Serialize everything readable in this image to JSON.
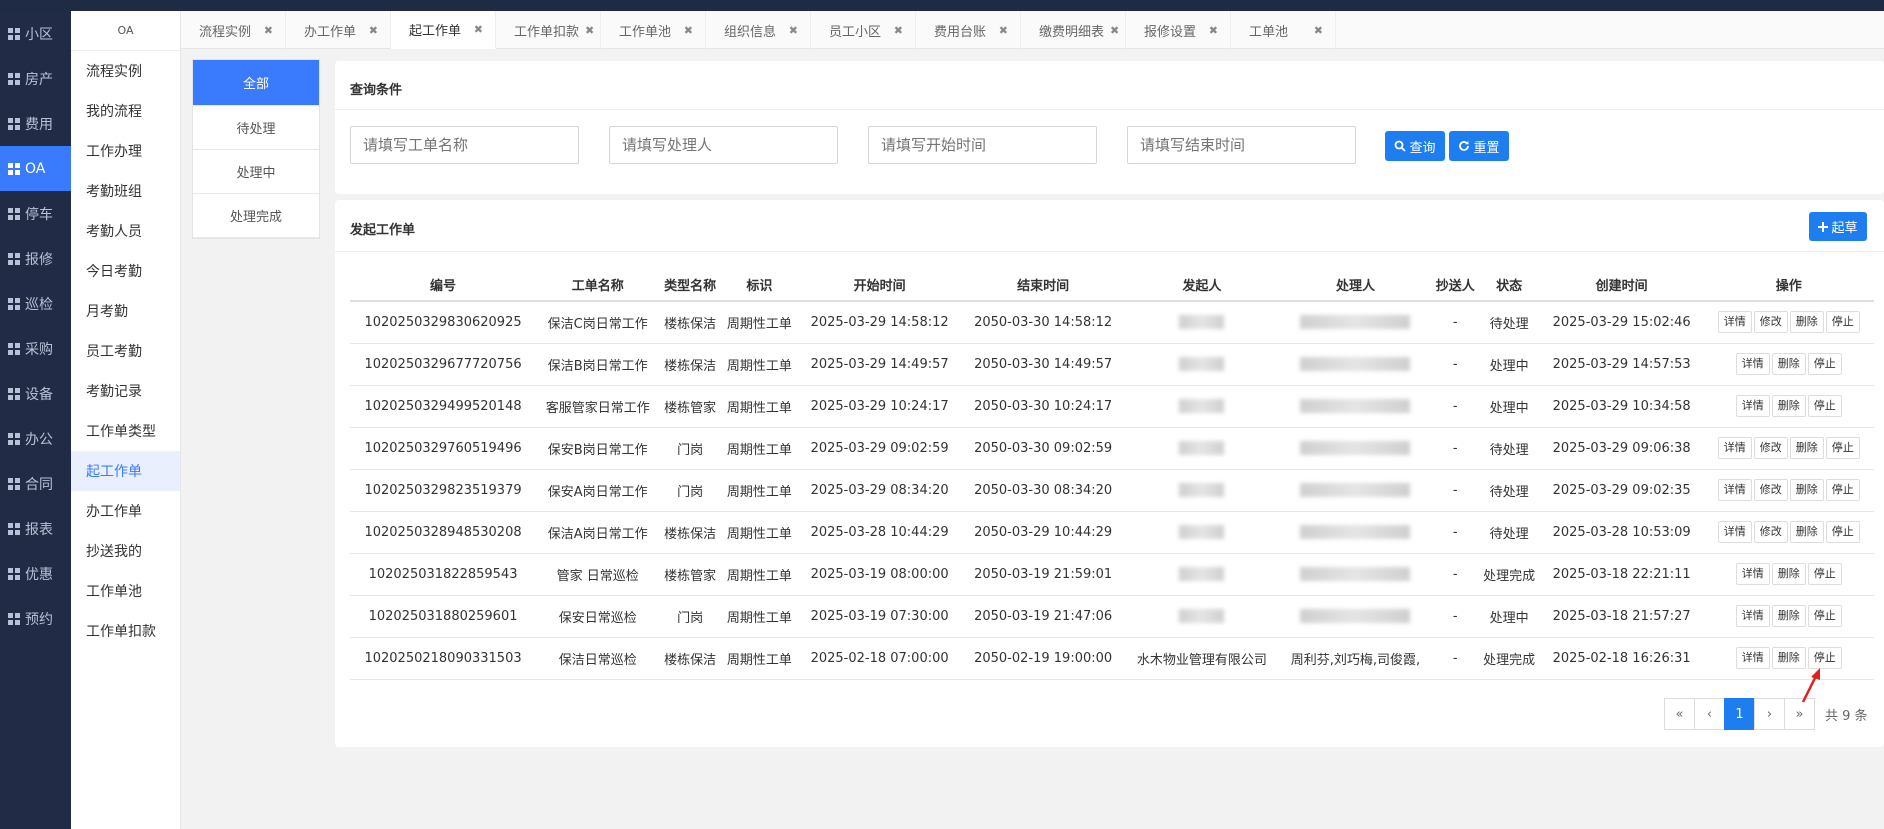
{
  "nav": [
    {
      "label": "小区"
    },
    {
      "label": "房产"
    },
    {
      "label": "费用"
    },
    {
      "label": "OA",
      "active": true
    },
    {
      "label": "停车"
    },
    {
      "label": "报修"
    },
    {
      "label": "巡检"
    },
    {
      "label": "采购"
    },
    {
      "label": "设备"
    },
    {
      "label": "办公"
    },
    {
      "label": "合同"
    },
    {
      "label": "报表"
    },
    {
      "label": "优惠"
    },
    {
      "label": "预约"
    }
  ],
  "sub": {
    "header": "OA",
    "items": [
      "流程实例",
      "我的流程",
      "工作办理",
      "考勤班组",
      "考勤人员",
      "今日考勤",
      "月考勤",
      "员工考勤",
      "考勤记录",
      "工作单类型",
      "起工作单",
      "办工作单",
      "抄送我的",
      "工作单池",
      "工作单扣款"
    ],
    "active_index": 10
  },
  "tabs": [
    "流程实例",
    "办工作单",
    "起工作单",
    "工作单扣款",
    "工作单池",
    "组织信息",
    "员工小区",
    "费用台账",
    "缴费明细表",
    "报修设置",
    "工单池"
  ],
  "active_tab": 2,
  "filter": [
    "全部",
    "待处理",
    "处理中",
    "处理完成"
  ],
  "query": {
    "title": "查询条件",
    "name_placeholder": "请填写工单名称",
    "handler_placeholder": "请填写处理人",
    "start_placeholder": "请填写开始时间",
    "end_placeholder": "请填写结束时间",
    "search_label": "查询",
    "reset_label": "重置"
  },
  "list": {
    "title": "发起工作单",
    "create_label": "起草",
    "columns": [
      "编号",
      "工单名称",
      "类型名称",
      "标识",
      "开始时间",
      "结束时间",
      "发起人",
      "处理人",
      "抄送人",
      "状态",
      "创建时间",
      "操作"
    ],
    "rows": [
      {
        "id": "1020250329830620925",
        "name": "保洁C岗日常工作",
        "type": "楼栋保洁",
        "tag": "周期性工单",
        "start": "2025-03-29 14:58:12",
        "end": "2050-03-30 14:58:12",
        "initiator": "",
        "handler": "",
        "cc": "-",
        "status": "待处理",
        "created": "2025-03-29 15:02:46",
        "ops": [
          "详情",
          "修改",
          "删除",
          "停止"
        ]
      },
      {
        "id": "1020250329677720756",
        "name": "保洁B岗日常工作",
        "type": "楼栋保洁",
        "tag": "周期性工单",
        "start": "2025-03-29 14:49:57",
        "end": "2050-03-30 14:49:57",
        "initiator": "",
        "handler": "",
        "cc": "-",
        "status": "处理中",
        "created": "2025-03-29 14:57:53",
        "ops": [
          "详情",
          "删除",
          "停止"
        ]
      },
      {
        "id": "1020250329499520148",
        "name": "客服管家日常工作",
        "type": "楼栋管家",
        "tag": "周期性工单",
        "start": "2025-03-29 10:24:17",
        "end": "2050-03-30 10:24:17",
        "initiator": "",
        "handler": "",
        "cc": "-",
        "status": "处理中",
        "created": "2025-03-29 10:34:58",
        "ops": [
          "详情",
          "删除",
          "停止"
        ]
      },
      {
        "id": "1020250329760519496",
        "name": "保安B岗日常工作",
        "type": "门岗",
        "tag": "周期性工单",
        "start": "2025-03-29 09:02:59",
        "end": "2050-03-30 09:02:59",
        "initiator": "",
        "handler": "",
        "cc": "-",
        "status": "待处理",
        "created": "2025-03-29 09:06:38",
        "ops": [
          "详情",
          "修改",
          "删除",
          "停止"
        ]
      },
      {
        "id": "1020250329823519379",
        "name": "保安A岗日常工作",
        "type": "门岗",
        "tag": "周期性工单",
        "start": "2025-03-29 08:34:20",
        "end": "2050-03-30 08:34:20",
        "initiator": "",
        "handler": "",
        "cc": "-",
        "status": "待处理",
        "created": "2025-03-29 09:02:35",
        "ops": [
          "详情",
          "修改",
          "删除",
          "停止"
        ]
      },
      {
        "id": "1020250328948530208",
        "name": "保洁A岗日常工作",
        "type": "楼栋保洁",
        "tag": "周期性工单",
        "start": "2025-03-28 10:44:29",
        "end": "2050-03-29 10:44:29",
        "initiator": "",
        "handler": "",
        "cc": "-",
        "status": "待处理",
        "created": "2025-03-28 10:53:09",
        "ops": [
          "详情",
          "修改",
          "删除",
          "停止"
        ]
      },
      {
        "id": "102025031822859543",
        "name": "管家 日常巡检",
        "type": "楼栋管家",
        "tag": "周期性工单",
        "start": "2025-03-19 08:00:00",
        "end": "2050-03-19 21:59:01",
        "initiator": "",
        "handler": "",
        "cc": "-",
        "status": "处理完成",
        "created": "2025-03-18 22:21:11",
        "ops": [
          "详情",
          "删除",
          "停止"
        ]
      },
      {
        "id": "102025031880259601",
        "name": "保安日常巡检",
        "type": "门岗",
        "tag": "周期性工单",
        "start": "2025-03-19 07:30:00",
        "end": "2050-03-19 21:47:06",
        "initiator": "",
        "handler": "",
        "cc": "-",
        "status": "处理中",
        "created": "2025-03-18 21:57:27",
        "ops": [
          "详情",
          "删除",
          "停止"
        ]
      },
      {
        "id": "1020250218090331503",
        "name": "保洁日常巡检",
        "type": "楼栋保洁",
        "tag": "周期性工单",
        "start": "2025-02-18 07:00:00",
        "end": "2050-02-19 19:00:00",
        "initiator": "水木物业管理有限公司",
        "handler": "周利芬,刘巧梅,司俊霞,",
        "cc": "-",
        "status": "处理完成",
        "created": "2025-02-18 16:26:31",
        "ops": [
          "详情",
          "删除",
          "停止"
        ]
      }
    ]
  },
  "pagination": {
    "first": "«",
    "prev": "‹",
    "current": "1",
    "next": "›",
    "last": "»",
    "total": "共 9 条"
  },
  "colors": {
    "accent": "#1e7ef0",
    "nav_bg": "#222b45",
    "arrow": "#e02020"
  }
}
